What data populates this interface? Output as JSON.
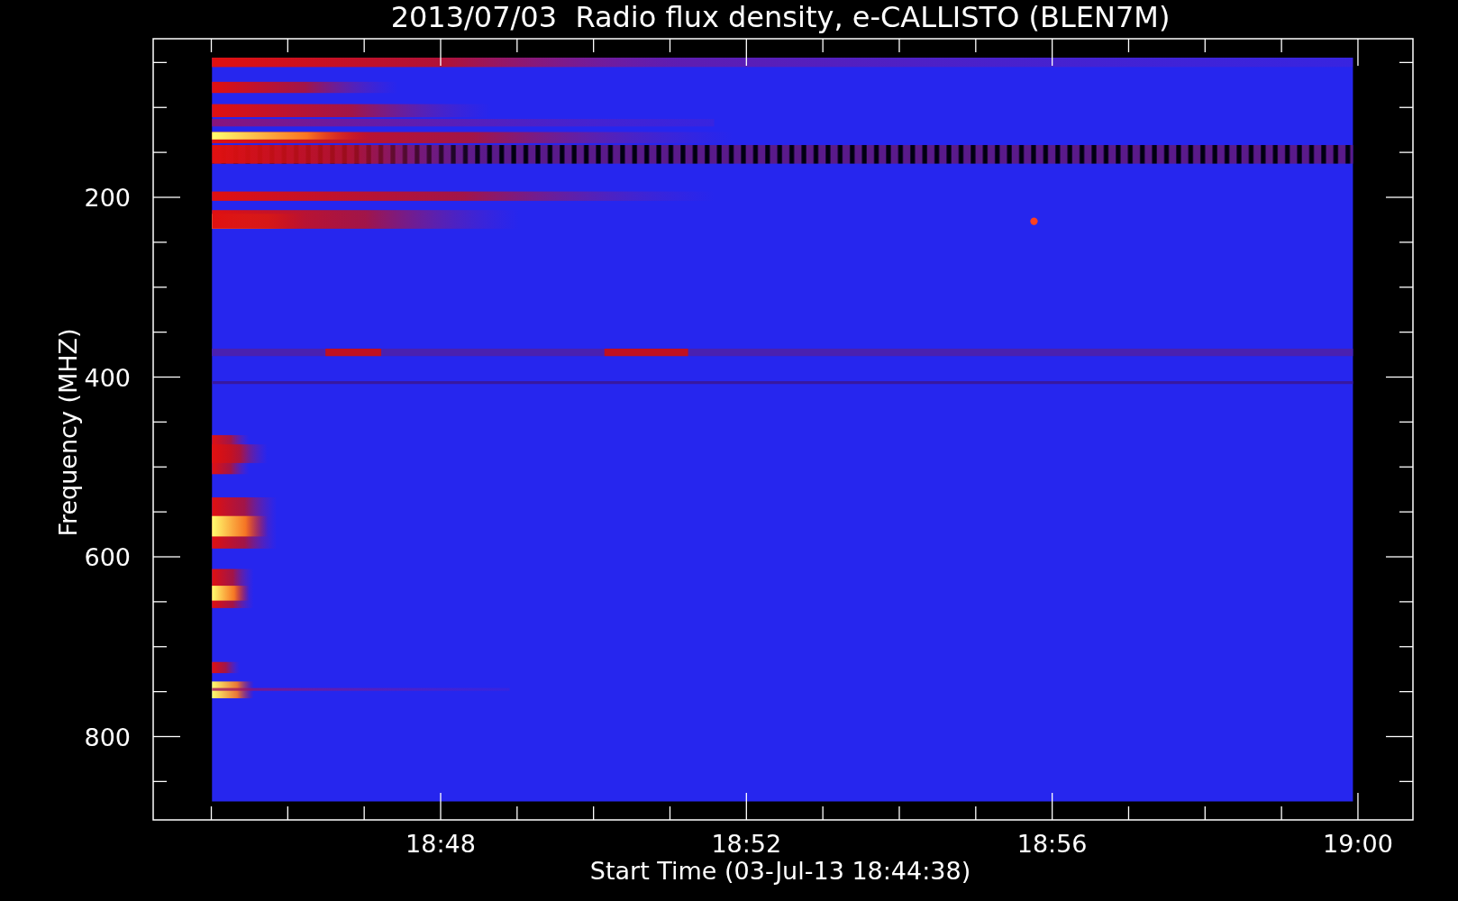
{
  "title": "2013/07/03  Radio flux density, e-CALLISTO (BLEN7M)",
  "y_axis": {
    "label": "Frequency (MHZ)",
    "tick_labels": [
      "200",
      "400",
      "600",
      "800"
    ]
  },
  "x_axis": {
    "label": "Start Time (03-Jul-13 18:44:38)",
    "tick_labels": [
      "18:48",
      "18:52",
      "18:56",
      "19:00"
    ]
  }
}
